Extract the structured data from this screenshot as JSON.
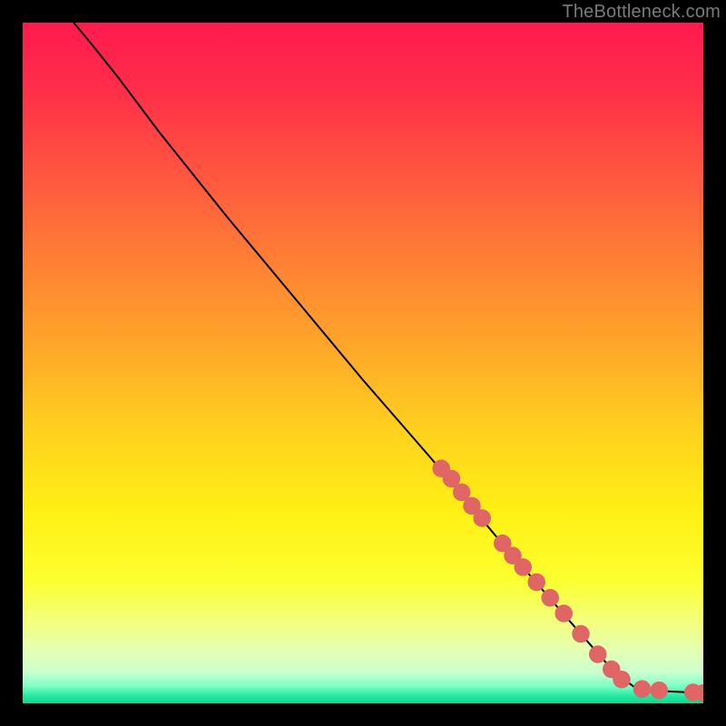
{
  "attribution": "TheBottleneck.com",
  "gradient": {
    "stops": [
      {
        "offset": 0.0,
        "color": "#ff1a4f"
      },
      {
        "offset": 0.1,
        "color": "#ff2e49"
      },
      {
        "offset": 0.22,
        "color": "#ff5540"
      },
      {
        "offset": 0.35,
        "color": "#ff7f34"
      },
      {
        "offset": 0.48,
        "color": "#ffa829"
      },
      {
        "offset": 0.6,
        "color": "#ffd11e"
      },
      {
        "offset": 0.72,
        "color": "#fff015"
      },
      {
        "offset": 0.82,
        "color": "#fcff2f"
      },
      {
        "offset": 0.88,
        "color": "#f3ff7d"
      },
      {
        "offset": 0.92,
        "color": "#e7ffb0"
      },
      {
        "offset": 0.955,
        "color": "#c9ffcf"
      },
      {
        "offset": 0.975,
        "color": "#7dffc4"
      },
      {
        "offset": 0.99,
        "color": "#22e7a0"
      },
      {
        "offset": 1.0,
        "color": "#0fd98f"
      }
    ]
  },
  "chart_data": {
    "type": "line",
    "title": "",
    "xlabel": "",
    "ylabel": "",
    "xlim": [
      0,
      100
    ],
    "ylim": [
      0,
      100
    ],
    "curve": [
      {
        "x": 7.5,
        "y": 100.0
      },
      {
        "x": 10.0,
        "y": 97.0
      },
      {
        "x": 14.0,
        "y": 92.0
      },
      {
        "x": 20.0,
        "y": 84.0
      },
      {
        "x": 30.0,
        "y": 71.5
      },
      {
        "x": 40.0,
        "y": 59.5
      },
      {
        "x": 50.0,
        "y": 47.5
      },
      {
        "x": 60.0,
        "y": 36.0
      },
      {
        "x": 70.0,
        "y": 24.0
      },
      {
        "x": 80.0,
        "y": 12.5
      },
      {
        "x": 87.0,
        "y": 4.5
      },
      {
        "x": 90.0,
        "y": 2.3
      },
      {
        "x": 94.0,
        "y": 1.8
      },
      {
        "x": 98.0,
        "y": 1.6
      },
      {
        "x": 100.0,
        "y": 1.5
      }
    ],
    "markers": [
      {
        "x": 61.5,
        "y": 34.5
      },
      {
        "x": 63.0,
        "y": 33.0
      },
      {
        "x": 64.5,
        "y": 31.0
      },
      {
        "x": 66.0,
        "y": 29.0
      },
      {
        "x": 67.5,
        "y": 27.2
      },
      {
        "x": 70.5,
        "y": 23.5
      },
      {
        "x": 72.0,
        "y": 21.7
      },
      {
        "x": 73.5,
        "y": 20.0
      },
      {
        "x": 75.5,
        "y": 17.8
      },
      {
        "x": 77.5,
        "y": 15.5
      },
      {
        "x": 79.5,
        "y": 13.2
      },
      {
        "x": 82.0,
        "y": 10.2
      },
      {
        "x": 84.5,
        "y": 7.2
      },
      {
        "x": 86.5,
        "y": 5.0
      },
      {
        "x": 88.0,
        "y": 3.5
      },
      {
        "x": 91.0,
        "y": 2.1
      },
      {
        "x": 93.5,
        "y": 1.9
      },
      {
        "x": 98.5,
        "y": 1.6
      },
      {
        "x": 100.0,
        "y": 1.5
      }
    ],
    "marker_radius": 1.3,
    "marker_color": "#e06666",
    "line_color": "#000000"
  }
}
